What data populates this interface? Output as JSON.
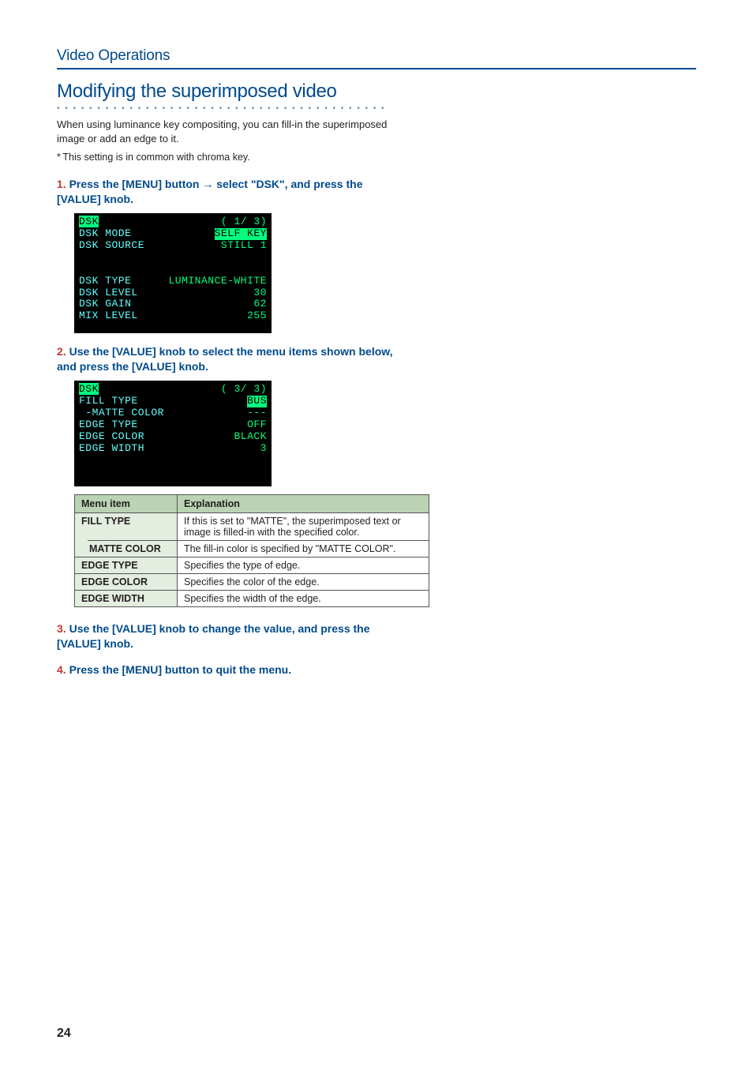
{
  "section": "Video Operations",
  "heading": "Modifying the superimposed video",
  "intro": "When using luminance key compositing, you can fill-in the superimposed image or add an edge to it.",
  "note": "* This setting is in common with chroma key.",
  "steps": {
    "s1": {
      "num": "1.",
      "text_a": "Press the [MENU] button ",
      "arrow": "→",
      "text_b": " select \"DSK\", and press the [VALUE] knob."
    },
    "s2": {
      "num": "2.",
      "text": "Use the [VALUE] knob to select the menu items shown below, and press the [VALUE] knob."
    },
    "s3": {
      "num": "3.",
      "text": "Use the [VALUE] knob to change the value, and press the [VALUE] knob."
    },
    "s4": {
      "num": "4.",
      "text": "Press the [MENU] button to quit the menu."
    }
  },
  "lcd1": {
    "title": "DSK",
    "page": "( 1/ 3)",
    "rows": [
      {
        "l": "DSK MODE",
        "v": "SELF KEY"
      },
      {
        "l": "DSK SOURCE",
        "v": "STILL 1"
      }
    ],
    "rows2": [
      {
        "l": "DSK TYPE",
        "v": "LUMINANCE-WHITE"
      },
      {
        "l": "DSK LEVEL",
        "v": "30"
      },
      {
        "l": "DSK GAIN",
        "v": "62"
      },
      {
        "l": "MIX LEVEL",
        "v": "255"
      }
    ]
  },
  "lcd2": {
    "title": "DSK",
    "page": "( 3/ 3)",
    "rows": [
      {
        "l": "FILL TYPE",
        "v": "BUS"
      },
      {
        "l": " -MATTE COLOR",
        "v": "---"
      },
      {
        "l": "EDGE TYPE",
        "v": "OFF"
      },
      {
        "l": "EDGE COLOR",
        "v": "BLACK"
      },
      {
        "l": "EDGE WIDTH",
        "v": "3"
      }
    ]
  },
  "table": {
    "h1": "Menu item",
    "h2": "Explanation",
    "rows": {
      "fill_type": {
        "m": "FILL TYPE",
        "e": "If this is set to \"MATTE\", the superimposed text or image is filled-in with the specified color."
      },
      "matte_color": {
        "m": "MATTE COLOR",
        "e": "The fill-in color is specified by \"MATTE COLOR\"."
      },
      "edge_type": {
        "m": "EDGE TYPE",
        "e": "Specifies the type of edge."
      },
      "edge_color": {
        "m": "EDGE COLOR",
        "e": "Specifies the color of the edge."
      },
      "edge_width": {
        "m": "EDGE WIDTH",
        "e": "Specifies the width of the edge."
      }
    }
  },
  "page_number": "24"
}
